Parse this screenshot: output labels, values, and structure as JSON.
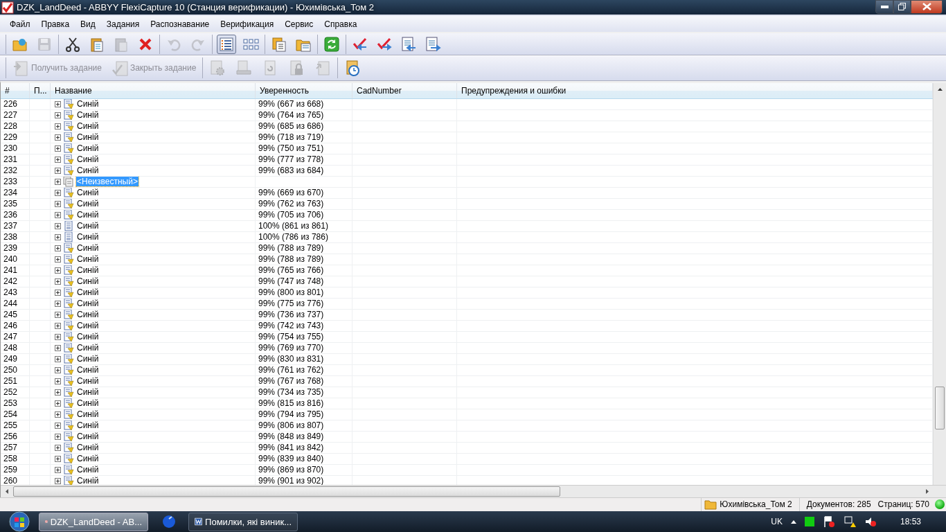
{
  "window": {
    "title": "DZK_LandDeed - ABBYY FlexiCapture 10 (Станция верификации) - Юхимівська_Том 2"
  },
  "menu": [
    "Файл",
    "Правка",
    "Вид",
    "Задания",
    "Распознавание",
    "Верификация",
    "Сервис",
    "Справка"
  ],
  "toolbar": [
    [
      {
        "disabled": false,
        "selected": false
      },
      {
        "disabled": true,
        "selected": false
      }
    ],
    [
      {
        "disabled": false,
        "selected": false
      },
      {
        "disabled": false,
        "selected": false
      },
      {
        "disabled": true,
        "selected": false
      },
      {
        "disabled": false,
        "selected": false
      }
    ],
    [
      {
        "disabled": true,
        "selected": false
      },
      {
        "disabled": true,
        "selected": false
      }
    ],
    [
      {
        "disabled": false,
        "selected": true
      },
      {
        "disabled": false,
        "selected": false
      }
    ],
    [
      {
        "disabled": false,
        "selected": false
      },
      {
        "disabled": false,
        "selected": false
      }
    ],
    [
      {
        "disabled": false,
        "selected": false
      }
    ],
    [
      {
        "disabled": false,
        "selected": false
      },
      {
        "disabled": false,
        "selected": false
      },
      {
        "disabled": false,
        "selected": false
      },
      {
        "disabled": false,
        "selected": false
      }
    ]
  ],
  "task_toolbar": [
    [
      {
        "label": "Получить задание",
        "disabled": true
      },
      {
        "label": "Закрыть задание",
        "disabled": true
      }
    ],
    [
      {
        "disabled": true
      },
      {
        "disabled": true
      },
      {
        "disabled": true
      },
      {
        "disabled": true
      },
      {
        "disabled": true
      }
    ],
    [
      {
        "disabled": false
      }
    ]
  ],
  "table": {
    "columns": [
      "#",
      "П...",
      "Название",
      "Уверенность",
      "CadNumber",
      "Предупреждения и ошибки"
    ],
    "rows": [
      {
        "number": "226",
        "kind": "flagged",
        "name": "Синій",
        "confidence": "99% (667 из 668)",
        "selected": false
      },
      {
        "number": "227",
        "kind": "flagged",
        "name": "Синій",
        "confidence": "99% (764 из 765)",
        "selected": false
      },
      {
        "number": "228",
        "kind": "flagged",
        "name": "Синій",
        "confidence": "99% (685 из 686)",
        "selected": false
      },
      {
        "number": "229",
        "kind": "flagged",
        "name": "Синій",
        "confidence": "99% (718 из 719)",
        "selected": false
      },
      {
        "number": "230",
        "kind": "flagged",
        "name": "Синій",
        "confidence": "99% (750 из 751)",
        "selected": false
      },
      {
        "number": "231",
        "kind": "flagged",
        "name": "Синій",
        "confidence": "99% (777 из 778)",
        "selected": false
      },
      {
        "number": "232",
        "kind": "flagged",
        "name": "Синій",
        "confidence": "99% (683 из 684)",
        "selected": false
      },
      {
        "number": "233",
        "kind": "unknown",
        "name": "<Неизвестный>",
        "selected": true
      },
      {
        "number": "234",
        "kind": "flagged",
        "name": "Синій",
        "confidence": "99% (669 из 670)",
        "selected": false
      },
      {
        "number": "235",
        "kind": "flagged",
        "name": "Синій",
        "confidence": "99% (762 из 763)",
        "selected": false
      },
      {
        "number": "236",
        "kind": "flagged",
        "name": "Синій",
        "confidence": "99% (705 из 706)",
        "selected": false
      },
      {
        "number": "237",
        "kind": "document",
        "name": "Синій",
        "confidence": "100% (861 из 861)",
        "selected": false
      },
      {
        "number": "238",
        "kind": "document",
        "name": "Синій",
        "confidence": "100% (786 из 786)",
        "selected": false
      },
      {
        "number": "239",
        "kind": "flagged",
        "name": "Синій",
        "confidence": "99% (788 из 789)",
        "selected": false
      },
      {
        "number": "240",
        "kind": "flagged",
        "name": "Синій",
        "confidence": "99% (788 из 789)",
        "selected": false
      },
      {
        "number": "241",
        "kind": "flagged",
        "name": "Синій",
        "confidence": "99% (765 из 766)",
        "selected": false
      },
      {
        "number": "242",
        "kind": "flagged",
        "name": "Синій",
        "confidence": "99% (747 из 748)",
        "selected": false
      },
      {
        "number": "243",
        "kind": "flagged",
        "name": "Синій",
        "confidence": "99% (800 из 801)",
        "selected": false
      },
      {
        "number": "244",
        "kind": "flagged",
        "name": "Синій",
        "confidence": "99% (775 из 776)",
        "selected": false
      },
      {
        "number": "245",
        "kind": "flagged",
        "name": "Синій",
        "confidence": "99% (736 из 737)",
        "selected": false
      },
      {
        "number": "246",
        "kind": "flagged",
        "name": "Синій",
        "confidence": "99% (742 из 743)",
        "selected": false
      },
      {
        "number": "247",
        "kind": "flagged",
        "name": "Синій",
        "confidence": "99% (754 из 755)",
        "selected": false
      },
      {
        "number": "248",
        "kind": "flagged",
        "name": "Синій",
        "confidence": "99% (769 из 770)",
        "selected": false
      },
      {
        "number": "249",
        "kind": "flagged",
        "name": "Синій",
        "confidence": "99% (830 из 831)",
        "selected": false
      },
      {
        "number": "250",
        "kind": "flagged",
        "name": "Синій",
        "confidence": "99% (761 из 762)",
        "selected": false
      },
      {
        "number": "251",
        "kind": "flagged",
        "name": "Синій",
        "confidence": "99% (767 из 768)",
        "selected": false
      },
      {
        "number": "252",
        "kind": "flagged",
        "name": "Синій",
        "confidence": "99% (734 из 735)",
        "selected": false
      },
      {
        "number": "253",
        "kind": "flagged",
        "name": "Синій",
        "confidence": "99% (815 из 816)",
        "selected": false
      },
      {
        "number": "254",
        "kind": "flagged",
        "name": "Синій",
        "confidence": "99% (794 из 795)",
        "selected": false
      },
      {
        "number": "255",
        "kind": "flagged",
        "name": "Синій",
        "confidence": "99% (806 из 807)",
        "selected": false
      },
      {
        "number": "256",
        "kind": "flagged",
        "name": "Синій",
        "confidence": "99% (848 из 849)",
        "selected": false
      },
      {
        "number": "257",
        "kind": "flagged",
        "name": "Синій",
        "confidence": "99% (841 из 842)",
        "selected": false
      },
      {
        "number": "258",
        "kind": "flagged",
        "name": "Синій",
        "confidence": "99% (839 из 840)",
        "selected": false
      },
      {
        "number": "259",
        "kind": "flagged",
        "name": "Синій",
        "confidence": "99% (869 из 870)",
        "selected": false
      },
      {
        "number": "260",
        "kind": "flagged",
        "name": "Синій",
        "confidence": "99% (901 из 902)",
        "selected": false
      }
    ]
  },
  "status_bar": {
    "batch": "Юхимівська_Том 2",
    "documents": "Документов: 285",
    "pages": "Страниц: 570"
  },
  "taskbar": {
    "tasks": [
      {
        "label": "DZK_LandDeed - AB...",
        "kind": "app",
        "selected": true
      },
      {
        "kind": "pinned"
      },
      {
        "label": "Помилки, які виник...",
        "kind": "word",
        "selected": false
      }
    ],
    "language": "UK",
    "clock": "18:53"
  }
}
